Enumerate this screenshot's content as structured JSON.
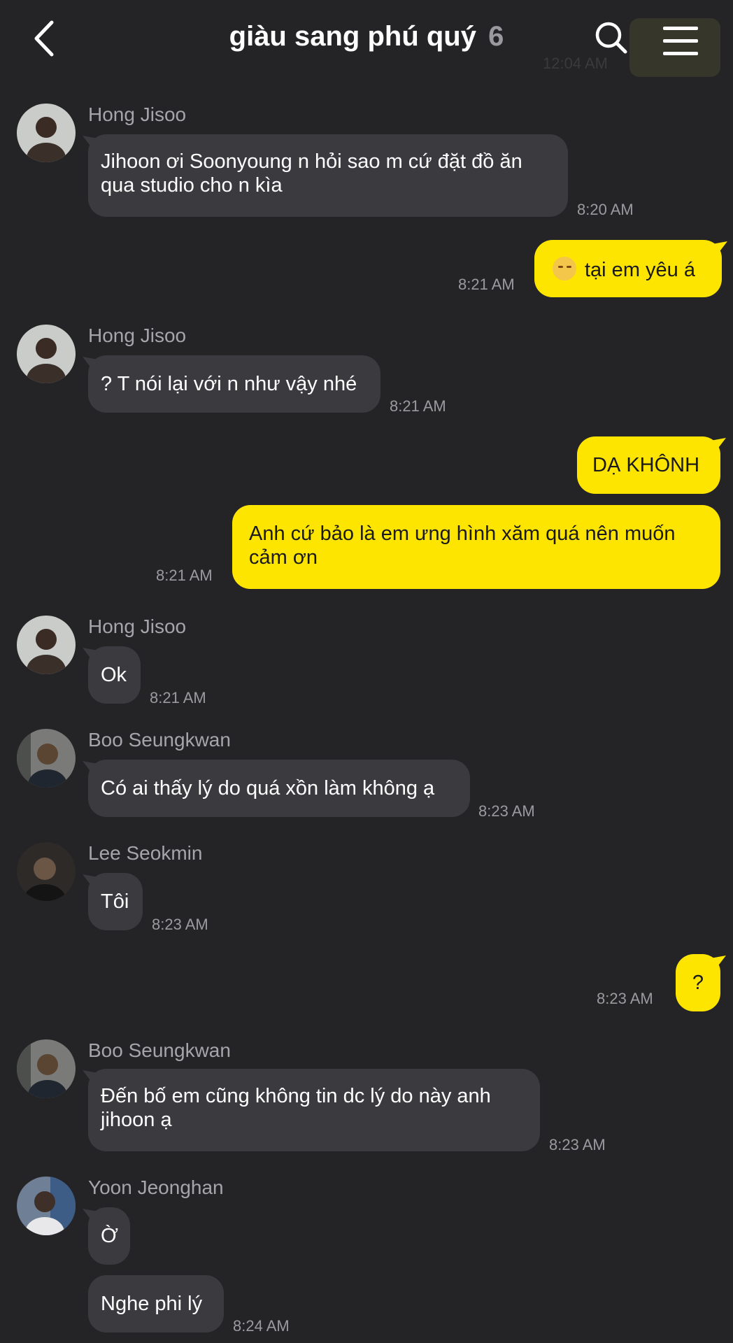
{
  "header": {
    "title": "giàu sang phú quý",
    "member_count": "6",
    "ghost_time": "12:04 AM"
  },
  "messages": [
    {
      "sender": "Hong Jisoo",
      "lines": [
        "Jihoon ơi Soonyoung n hỏi sao m cứ đặt đồ ăn",
        "qua studio cho n kìa"
      ],
      "time": "8:20 AM"
    },
    {
      "sender": "Me",
      "text": "tại em yêu á",
      "emoji": "relieved-face",
      "time": "8:21 AM"
    },
    {
      "sender": "Hong Jisoo",
      "text": "? T nói lại với n như vậy nhé",
      "time": "8:21 AM"
    },
    {
      "sender": "Me",
      "text": "DẠ KHÔNH"
    },
    {
      "sender": "Me",
      "lines": [
        "Anh cứ bảo là em ưng hình xăm quá nên muốn",
        "cảm ơn"
      ],
      "time": "8:21 AM"
    },
    {
      "sender": "Hong Jisoo",
      "text": "Ok",
      "time": "8:21 AM"
    },
    {
      "sender": "Boo Seungkwan",
      "text": "Có ai thấy lý do quá xồn làm không ạ",
      "time": "8:23 AM"
    },
    {
      "sender": "Lee Seokmin",
      "text": "Tôi",
      "time": "8:23 AM"
    },
    {
      "sender": "Me",
      "text": "?",
      "time": "8:23 AM"
    },
    {
      "sender": "Boo Seungkwan",
      "lines": [
        "Đến bố em cũng không tin dc lý do này anh",
        "jihoon ạ"
      ],
      "time": "8:23 AM"
    },
    {
      "sender": "Yoon Jeonghan",
      "text": "Ờ"
    },
    {
      "sender": "Yoon Jeonghan",
      "text": "Nghe phi lý",
      "time": "8:24 AM"
    }
  ],
  "colors": {
    "background": "#242426",
    "incoming_bubble": "#3b3b3f",
    "outgoing_bubble": "#fee500"
  }
}
